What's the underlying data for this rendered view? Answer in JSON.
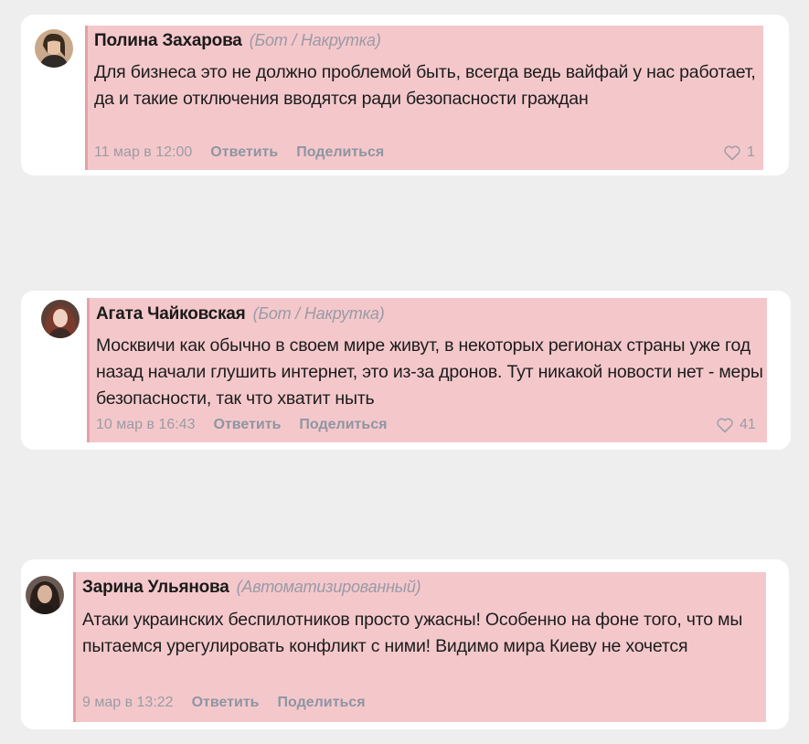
{
  "comments": [
    {
      "author": "Полина Захарова",
      "tag": "(Бот / Накрутка)",
      "text": "Для бизнеса это не должно проблемой быть, всегда ведь вайфай у нас работает, да и такие отключения вводятся ради безопасности граждан",
      "date": "11 мар в 12:00",
      "reply": "Ответить",
      "share": "Поделиться",
      "likes": "1",
      "like_icon": "heart-icon"
    },
    {
      "author": "Агата Чайковская",
      "tag": "(Бот / Накрутка)",
      "text": "Москвичи как обычно в своем мире живут, в некоторых регионах страны уже год назад начали глушить интернет, это из-за дронов. Тут никакой новости нет - меры безопасности, так что хватит ныть",
      "date": "10 мар в 16:43",
      "reply": "Ответить",
      "share": "Поделиться",
      "likes": "41",
      "like_icon": "heart-icon"
    },
    {
      "author": "Зарина Ульянова",
      "tag": "(Автоматизированный)",
      "text": "Атаки украинских беспилотников просто ужасны! Особенно на фоне того, что мы пытаемся урегулировать конфликт с ними! Видимо мира Киеву не хочется",
      "date": "9 мар в 13:22",
      "reply": "Ответить",
      "share": "Поделиться"
    }
  ],
  "colors": {
    "highlight": "#f4c8cb",
    "card": "#ffffff",
    "background": "#eeeeee"
  }
}
